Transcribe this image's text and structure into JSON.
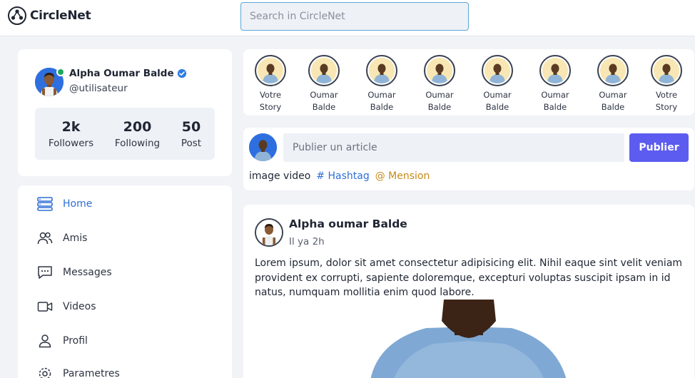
{
  "app": {
    "name": "CircleNet"
  },
  "search": {
    "placeholder": "Search in CircleNet"
  },
  "profile": {
    "name": "Alpha Oumar Balde",
    "handle": "@utilisateur",
    "stats": [
      {
        "value": "2k",
        "label": "Followers"
      },
      {
        "value": "200",
        "label": "Following"
      },
      {
        "value": "50",
        "label": "Post"
      }
    ]
  },
  "nav": {
    "items": [
      {
        "label": "Home",
        "icon": "home-icon",
        "active": true
      },
      {
        "label": "Amis",
        "icon": "friends-icon"
      },
      {
        "label": "Messages",
        "icon": "messages-icon"
      },
      {
        "label": "Videos",
        "icon": "video-icon"
      },
      {
        "label": "Profil",
        "icon": "user-icon"
      },
      {
        "label": "Parametres",
        "icon": "settings-icon"
      }
    ]
  },
  "stories": [
    {
      "line1": "Votre",
      "line2": "Story"
    },
    {
      "line1": "Oumar",
      "line2": "Balde"
    },
    {
      "line1": "Oumar",
      "line2": "Balde"
    },
    {
      "line1": "Oumar",
      "line2": "Balde"
    },
    {
      "line1": "Oumar",
      "line2": "Balde"
    },
    {
      "line1": "Oumar",
      "line2": "Balde"
    },
    {
      "line1": "Oumar",
      "line2": "Balde"
    },
    {
      "line1": "Votre",
      "line2": "Story"
    }
  ],
  "composer": {
    "placeholder": "Publier un article",
    "publish_label": "Publier",
    "tools": {
      "media": "image video",
      "hashtag": "# Hashtag",
      "mention": "@ Mension"
    }
  },
  "post": {
    "author": "Alpha oumar Balde",
    "time": "Il ya 2h",
    "text": "Lorem ipsum, dolor sit amet consectetur adipisicing elit. Nihil eaque sint velit veniam provident ex corrupti, sapiente doloremque, excepturi voluptas suscipit ipsam in id natus, numquam mollitia enim quod labore."
  },
  "colors": {
    "accent": "#2f6fd6",
    "publish_button": "#5c5cf0",
    "mention": "#c58a1a",
    "online": "#1ea85b",
    "background": "#f1f3f7"
  }
}
